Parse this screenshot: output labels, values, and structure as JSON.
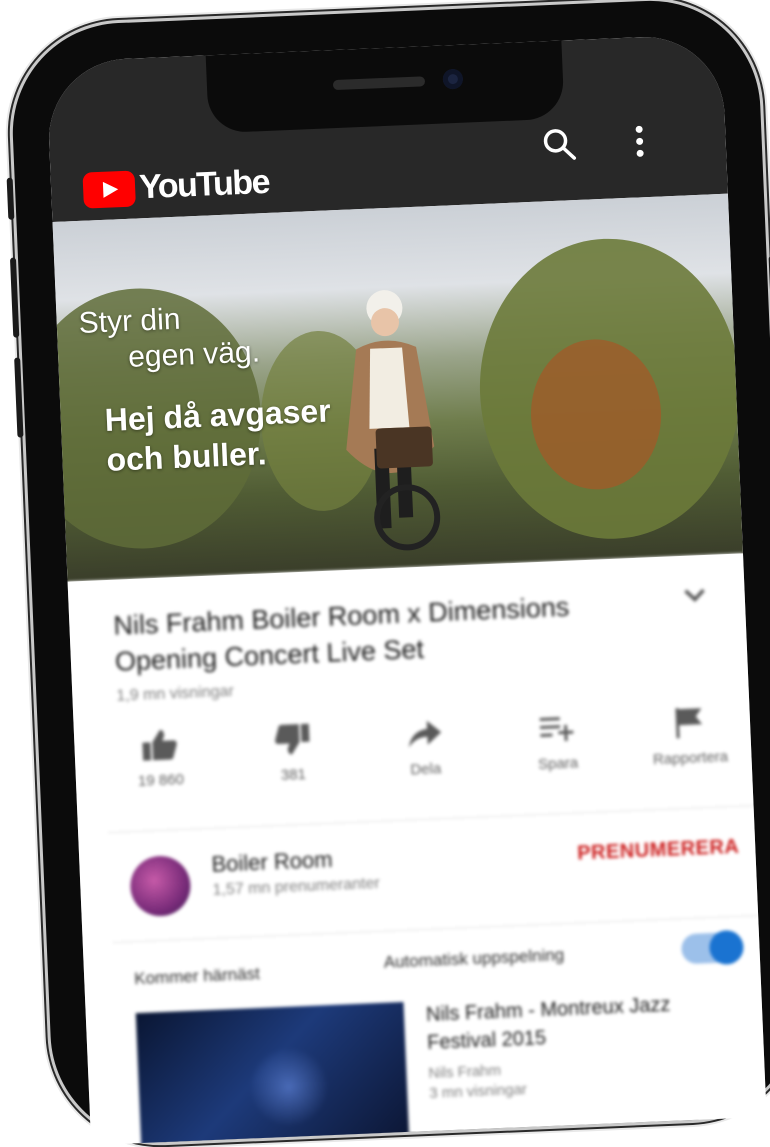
{
  "brand": {
    "name": "YouTube"
  },
  "hero": {
    "tagline_line1": "Styr din",
    "tagline_line2": "egen väg.",
    "headline_line1": "Hej då avgaser",
    "headline_line2": "och buller."
  },
  "video": {
    "title": "Nils Frahm Boiler Room x Dimensions Opening Concert Live Set",
    "views": "1,9 mn visningar"
  },
  "actions": [
    {
      "label": "19 860",
      "icon": "thumbs-up-icon"
    },
    {
      "label": "381",
      "icon": "thumbs-down-icon"
    },
    {
      "label": "Dela",
      "icon": "share-icon"
    },
    {
      "label": "Spara",
      "icon": "add-to-playlist-icon"
    },
    {
      "label": "Rapportera",
      "icon": "flag-icon"
    }
  ],
  "channel": {
    "name": "Boiler Room",
    "subscribers": "1,57 mn prenumeranter",
    "subscribe_label": "PRENUMERERA"
  },
  "up_next": {
    "label": "Kommer härnäst",
    "autoplay_label": "Automatisk uppspelning",
    "autoplay_on": true,
    "item": {
      "title": "Nils Frahm - Montreux Jazz Festival 2015",
      "channel": "Nils Frahm",
      "views": "3 mn visningar"
    }
  },
  "colors": {
    "header_bg": "#282828",
    "brand_red": "#ff0000",
    "subscribe_red": "#cc1f1f",
    "toggle_blue": "#1a73d1"
  }
}
